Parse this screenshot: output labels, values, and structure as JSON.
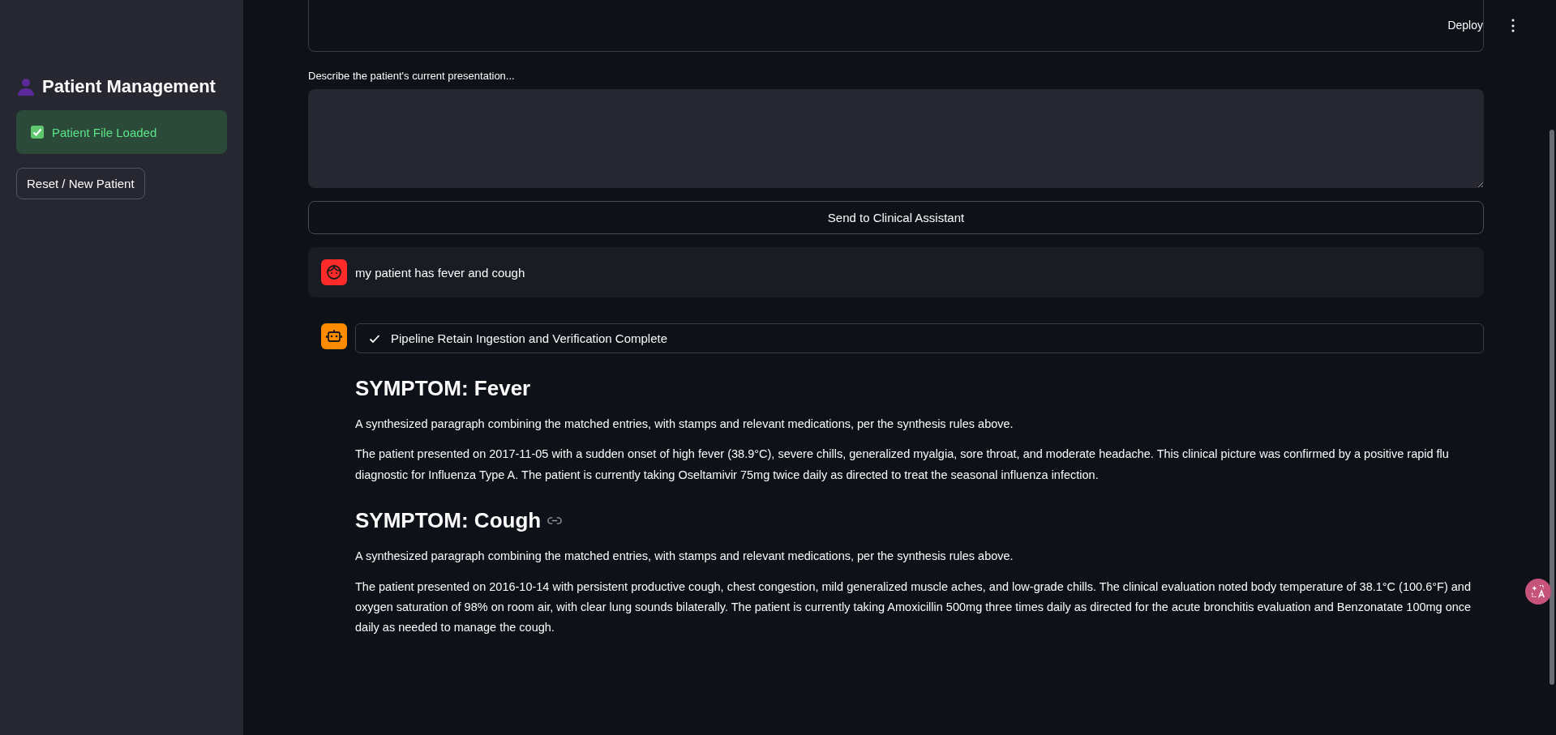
{
  "sidebar": {
    "title": "Patient Management",
    "status": "Patient File Loaded",
    "reset_button": "Reset / New Patient"
  },
  "header": {
    "deploy": "Deploy",
    "menu": "⋮"
  },
  "form": {
    "label": "Describe the patient's current presentation...",
    "submit": "Send to Clinical Assistant"
  },
  "messages": [
    {
      "kind": "user",
      "text": "my patient has fever and cough"
    },
    {
      "kind": "assistant",
      "status": "Pipeline Retain Ingestion and Verification Complete",
      "sections": [
        {
          "heading": "SYMPTOM: Fever",
          "link": false,
          "paragraphs": [
            "A synthesized paragraph combining the matched entries, with stamps and relevant medications, per the synthesis rules above.",
            "The patient presented on 2017-11-05 with a sudden onset of high fever (38.9°C), severe chills, generalized myalgia, sore throat, and moderate headache. This clinical picture was confirmed by a positive rapid flu diagnostic for Influenza Type A. The patient is currently taking Oseltamivir 75mg twice daily as directed to treat the seasonal influenza infection."
          ]
        },
        {
          "heading": "SYMPTOM: Cough",
          "link": true,
          "paragraphs": [
            "A synthesized paragraph combining the matched entries, with stamps and relevant medications, per the synthesis rules above.",
            "The patient presented on 2016-10-14 with persistent productive cough, chest congestion, mild generalized muscle aches, and low-grade chills. The clinical evaluation noted body temperature of 38.1°C (100.6°F) and oxygen saturation of 98% on room air, with clear lung sounds bilaterally. The patient is currently taking Amoxicillin 500mg three times daily as directed for the acute bronchitis evaluation and Benzonatate 100mg once daily as needed to manage the cough."
          ]
        }
      ]
    }
  ]
}
